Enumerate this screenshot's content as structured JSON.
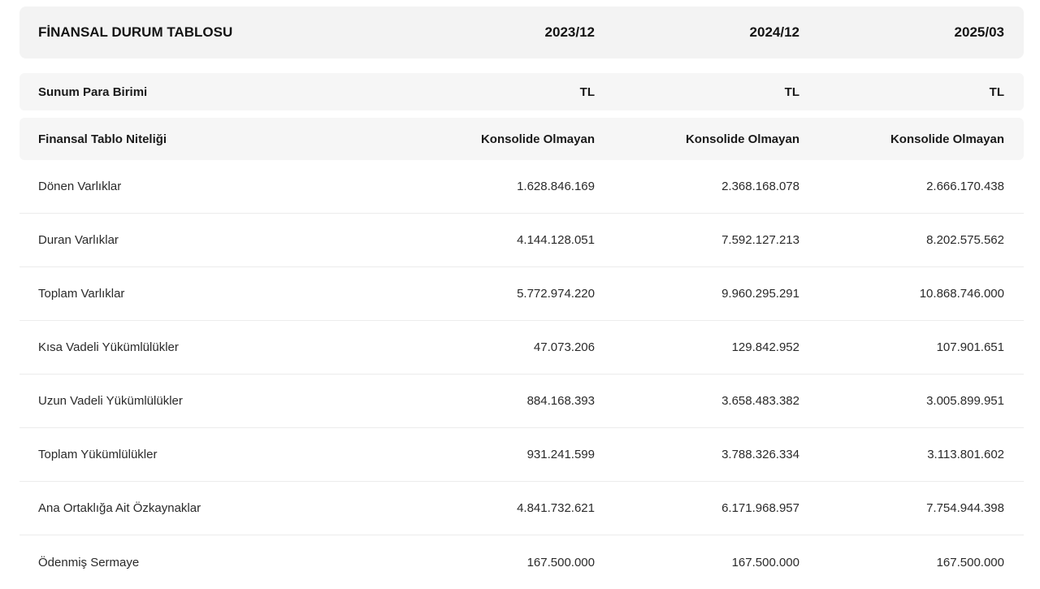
{
  "header": {
    "title": "FİNANSAL DURUM TABLOSU",
    "periods": [
      "2023/12",
      "2024/12",
      "2025/03"
    ]
  },
  "currency_row": {
    "label": "Sunum Para Birimi",
    "values": [
      "TL",
      "TL",
      "TL"
    ]
  },
  "nature_row": {
    "label": "Finansal Tablo Niteliği",
    "values": [
      "Konsolide Olmayan",
      "Konsolide Olmayan",
      "Konsolide Olmayan"
    ]
  },
  "rows": [
    {
      "label": "Dönen Varlıklar",
      "values": [
        "1.628.846.169",
        "2.368.168.078",
        "2.666.170.438"
      ]
    },
    {
      "label": "Duran Varlıklar",
      "values": [
        "4.144.128.051",
        "7.592.127.213",
        "8.202.575.562"
      ]
    },
    {
      "label": "Toplam Varlıklar",
      "values": [
        "5.772.974.220",
        "9.960.295.291",
        "10.868.746.000"
      ]
    },
    {
      "label": "Kısa Vadeli Yükümlülükler",
      "values": [
        "47.073.206",
        "129.842.952",
        "107.901.651"
      ]
    },
    {
      "label": "Uzun Vadeli Yükümlülükler",
      "values": [
        "884.168.393",
        "3.658.483.382",
        "3.005.899.951"
      ]
    },
    {
      "label": "Toplam Yükümlülükler",
      "values": [
        "931.241.599",
        "3.788.326.334",
        "3.113.801.602"
      ]
    },
    {
      "label": "Ana Ortaklığa Ait Özkaynaklar",
      "values": [
        "4.841.732.621",
        "6.171.968.957",
        "7.754.944.398"
      ]
    },
    {
      "label": "Ödenmiş Sermaye",
      "values": [
        "167.500.000",
        "167.500.000",
        "167.500.000"
      ]
    }
  ]
}
